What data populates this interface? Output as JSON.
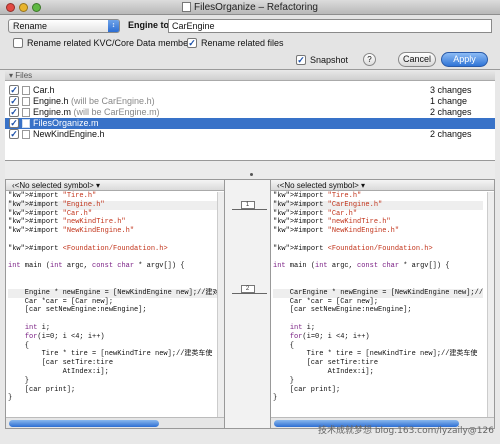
{
  "window": {
    "title": "FilesOrganize – Refactoring"
  },
  "toolbar": {
    "operation": "Rename",
    "engine_label": "Engine to",
    "engine_value": "CarEngine",
    "option1": "Rename related KVC/Core Data members",
    "option2": "Rename related files",
    "snapshot": "Snapshot",
    "help": "?",
    "cancel": "Cancel",
    "apply": "Apply"
  },
  "files": {
    "header": "Files",
    "rows": [
      {
        "name": "Car.h",
        "hint": "",
        "changes": "3 changes"
      },
      {
        "name": "Engine.h",
        "hint": " (will be CarEngine.h)",
        "changes": "1 change"
      },
      {
        "name": "Engine.m",
        "hint": " (will be CarEngine.m)",
        "changes": "2 changes"
      },
      {
        "name": "FilesOrganize.m",
        "hint": "",
        "changes": ""
      },
      {
        "name": "NewKindEngine.h",
        "hint": "",
        "changes": "2 changes"
      }
    ]
  },
  "diff": {
    "left_symbol": "<No selected symbol>",
    "right_symbol": "<No selected symbol>",
    "markers": [
      "1",
      "2"
    ],
    "left_code": [
      "#import \"Tire.h\"",
      "#import \"Engine.h\"",
      "#import \"Car.h\"",
      "#import \"newKindTire.h\"",
      "#import \"NewKindEngine.h\"",
      "",
      "#import <Foundation/Foundation.h>",
      "",
      "int main (int argc, const char * argv[]) {",
      "",
      "",
      "    Engine * newEngine = [NewKindEngine new];//建对",
      "    Car *car = [Car new];",
      "    [car setNewEngine:newEngine];",
      "",
      "    int i;",
      "    for(i=0; i <4; i++)",
      "    {",
      "        Tire * tire = [newKindTire new];//建类车使",
      "        [car setTire:tire",
      "             AtIndex:i];",
      "    }",
      "    [car print];",
      "}"
    ],
    "right_code": [
      "#import \"Tire.h\"",
      "#import \"CarEngine.h\"",
      "#import \"Car.h\"",
      "#import \"newKindTire.h\"",
      "#import \"NewKindEngine.h\"",
      "",
      "#import <Foundation/Foundation.h>",
      "",
      "int main (int argc, const char * argv[]) {",
      "",
      "",
      "    CarEngine * newEngine = [NewKindEngine new];//",
      "    Car *car = [Car new];",
      "    [car setNewEngine:newEngine];",
      "",
      "    int i;",
      "    for(i=0; i <4; i++)",
      "    {",
      "        Tire * tire = [newKindTire new];//建类车使",
      "        [car setTire:tire",
      "             AtIndex:i];",
      "    }",
      "    [car print];",
      "}"
    ]
  },
  "watermark": "技术成就梦想 blog.163.com/lyzaily@126"
}
